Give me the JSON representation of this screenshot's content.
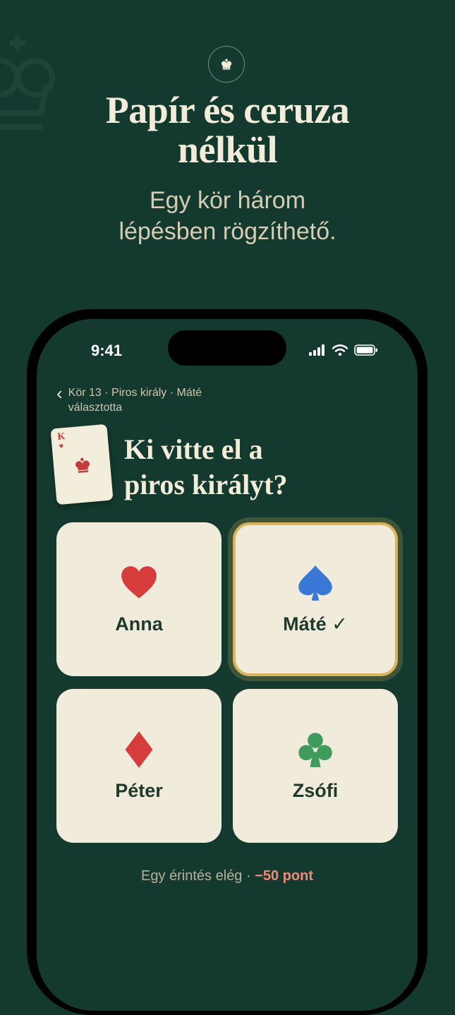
{
  "hero": {
    "title_line1": "Papír és ceruza",
    "title_line2": "nélkül",
    "subtitle_line1": "Egy kör három",
    "subtitle_line2": "lépésben rögzíthető."
  },
  "status_bar": {
    "time": "9:41"
  },
  "nav": {
    "breadcrumb": "Kör 13 · Piros király · Máté választotta"
  },
  "card": {
    "rank": "K",
    "suit": "♥"
  },
  "question": {
    "line1": "Ki vitte el a",
    "line2": "piros királyt?"
  },
  "players": [
    {
      "name": "Anna",
      "suit": "heart",
      "color": "#d63c3c",
      "selected": false
    },
    {
      "name": "Máté ✓",
      "suit": "spade",
      "color": "#3a78d8",
      "selected": true
    },
    {
      "name": "Péter",
      "suit": "diamond",
      "color": "#d63c3c",
      "selected": false
    },
    {
      "name": "Zsófi",
      "suit": "club",
      "color": "#3f9a5c",
      "selected": false
    }
  ],
  "hint": {
    "text": "Egy érintés elég · ",
    "points": "−50 pont"
  },
  "colors": {
    "background": "#143a2f",
    "cream": "#f1ebdc",
    "gold": "#d9b45c",
    "points": "#f08a7a"
  }
}
